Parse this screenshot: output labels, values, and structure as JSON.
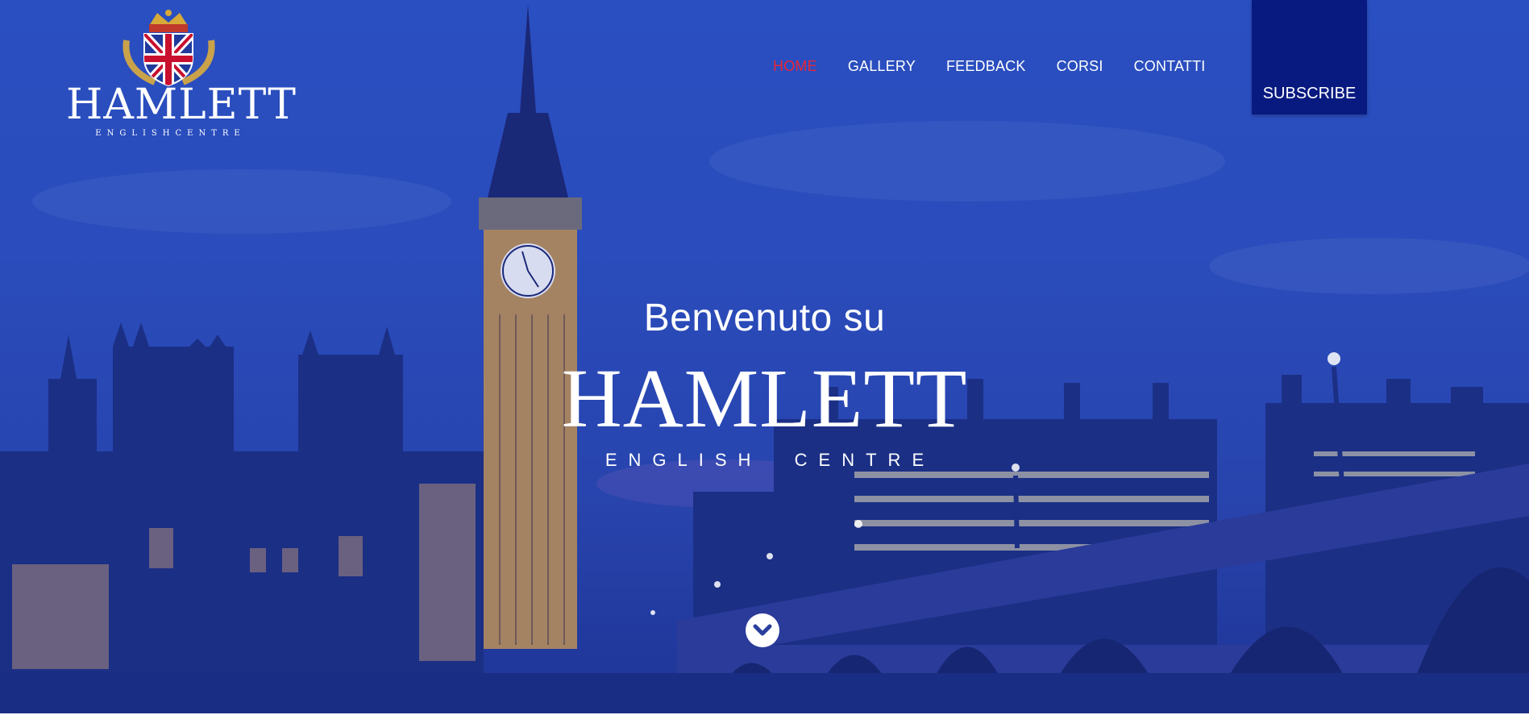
{
  "brand": {
    "logo_name": "HAMLETT",
    "logo_sub": "ENGLISHCENTRE"
  },
  "nav": {
    "items": [
      {
        "label": "HOME",
        "active": true
      },
      {
        "label": "GALLERY",
        "active": false
      },
      {
        "label": "FEEDBACK",
        "active": false
      },
      {
        "label": "CORSI",
        "active": false
      },
      {
        "label": "CONTATTI",
        "active": false
      }
    ],
    "subscribe_label": "SUBSCRIBE"
  },
  "hero": {
    "welcome": "Benvenuto su",
    "title": "HAMLETT",
    "subtitle": "ENGLISH  CENTRE",
    "scroll_icon": "chevron-down-icon"
  },
  "colors": {
    "overlay_blue": "#2a4cbc",
    "subscribe_bg": "#081a80",
    "active_nav": "#e8263a",
    "text": "#ffffff"
  }
}
